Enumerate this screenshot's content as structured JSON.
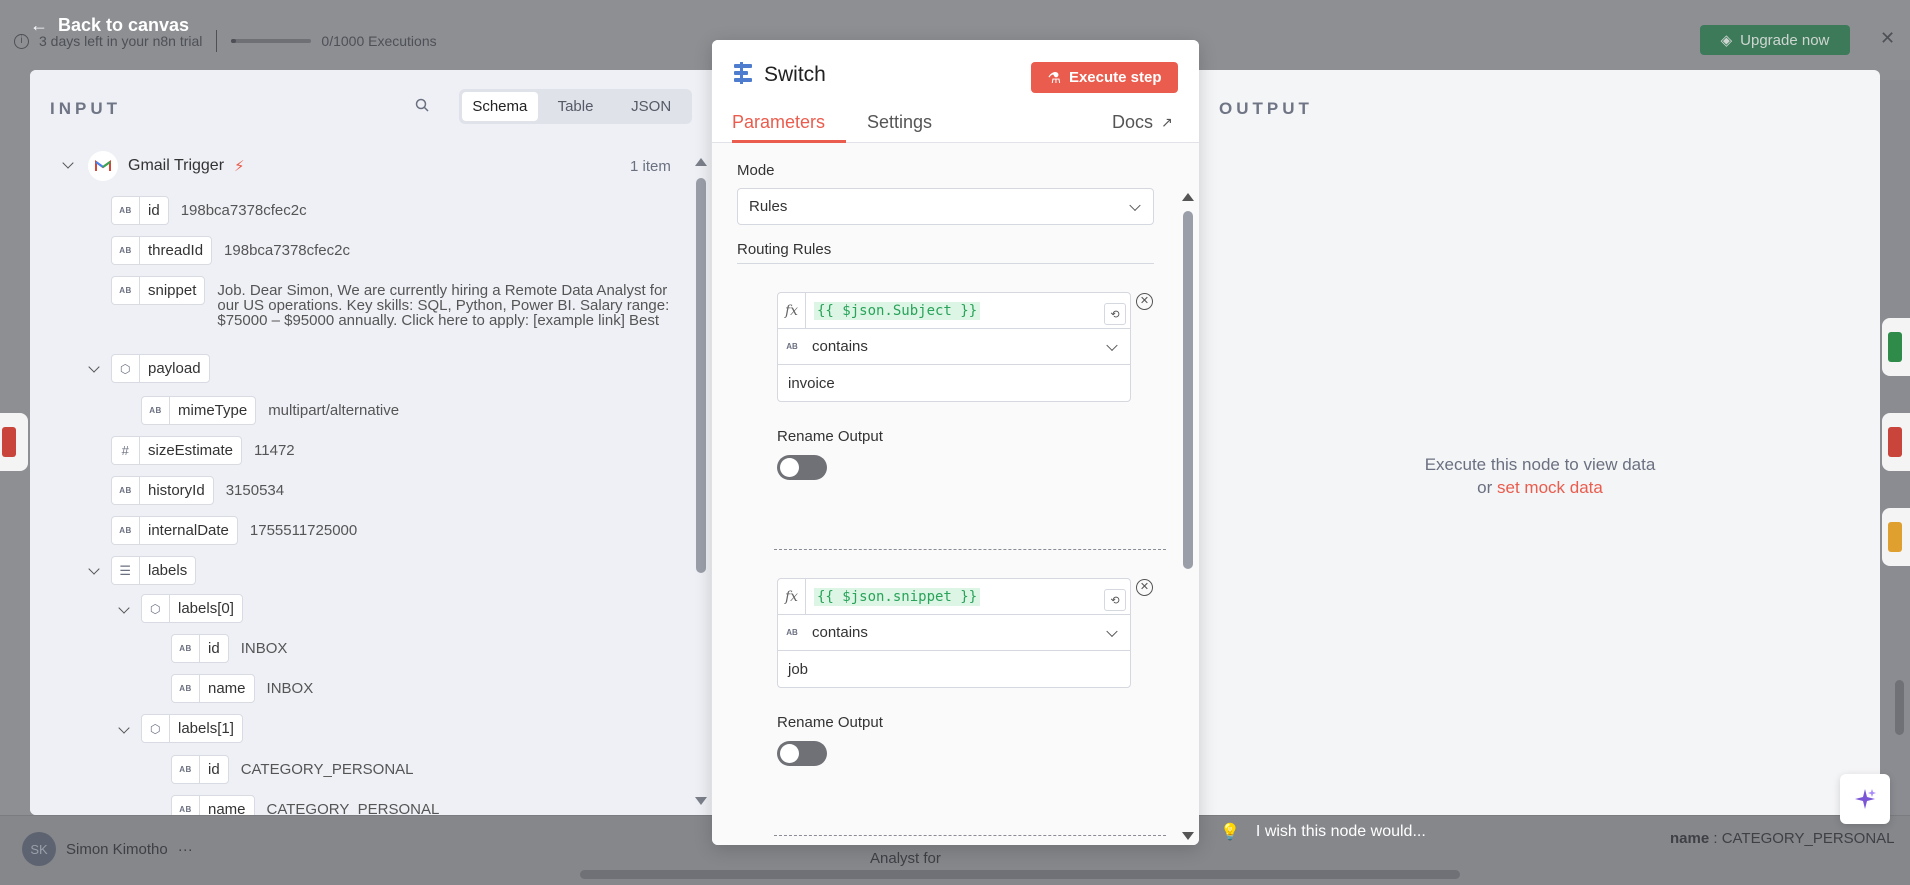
{
  "background": {
    "trial_text": "3 days left in your n8n trial",
    "executions": "0/1000 Executions",
    "upgrade_label": "Upgrade now",
    "user_initials": "SK",
    "user_name": "Simon Kimotho",
    "bg_snippet": "Analyst for",
    "bg_name_key": "name",
    "bg_name_value": ": CATEGORY_PERSONAL",
    "wish_text": "I wish this node would..."
  },
  "back_label": "Back to canvas",
  "input": {
    "title": "INPUT",
    "tabs": [
      "Schema",
      "Table",
      "JSON"
    ],
    "active_tab": "Schema",
    "node_name": "Gmail Trigger",
    "item_count": "1 item",
    "fields": {
      "id": {
        "key": "id",
        "value": "198bca7378cfec2c",
        "type": "AB"
      },
      "threadId": {
        "key": "threadId",
        "value": "198bca7378cfec2c",
        "type": "AB"
      },
      "snippet": {
        "key": "snippet",
        "value": "Job. Dear Simon, We are currently hiring a Remote Data Analyst for our US operations. Key skills: SQL, Python, Power BI. Salary range: $75000 – $95000 annually. Click here to apply: [example link] Best",
        "type": "AB"
      },
      "payload": {
        "key": "payload",
        "type": "obj"
      },
      "mimeType": {
        "key": "mimeType",
        "value": "multipart/alternative",
        "type": "AB"
      },
      "sizeEstimate": {
        "key": "sizeEstimate",
        "value": "11472",
        "type": "#"
      },
      "historyId": {
        "key": "historyId",
        "value": "3150534",
        "type": "AB"
      },
      "internalDate": {
        "key": "internalDate",
        "value": "1755511725000",
        "type": "AB"
      },
      "labels": {
        "key": "labels",
        "type": "list"
      },
      "labels0": {
        "key": "labels[0]",
        "type": "obj"
      },
      "labels0_id": {
        "key": "id",
        "value": "INBOX",
        "type": "AB"
      },
      "labels0_name": {
        "key": "name",
        "value": "INBOX",
        "type": "AB"
      },
      "labels1": {
        "key": "labels[1]",
        "type": "obj"
      },
      "labels1_id": {
        "key": "id",
        "value": "CATEGORY_PERSONAL",
        "type": "AB"
      },
      "labels1_name": {
        "key": "name",
        "value": "CATEGORY_PERSONAL",
        "type": "AB"
      }
    }
  },
  "switch": {
    "title": "Switch",
    "execute_label": "Execute step",
    "tabs": [
      "Parameters",
      "Settings"
    ],
    "docs_label": "Docs",
    "mode_label": "Mode",
    "mode_value": "Rules",
    "routing_label": "Routing Rules",
    "rules": [
      {
        "expression": "{{ $json.Subject }}",
        "operator": "contains",
        "value": "invoice",
        "rename_label": "Rename Output",
        "rename_on": false
      },
      {
        "expression": "{{ $json.snippet }}",
        "operator": "contains",
        "value": "job",
        "rename_label": "Rename Output",
        "rename_on": false
      }
    ]
  },
  "output": {
    "title": "OUTPUT",
    "message_line1": "Execute this node to view data",
    "message_or": "or",
    "mock_link": "set mock data"
  },
  "colors": {
    "accent": "#ea5c4d",
    "expression_green": "#29a35a",
    "upgrade_green": "#3c7a59"
  }
}
